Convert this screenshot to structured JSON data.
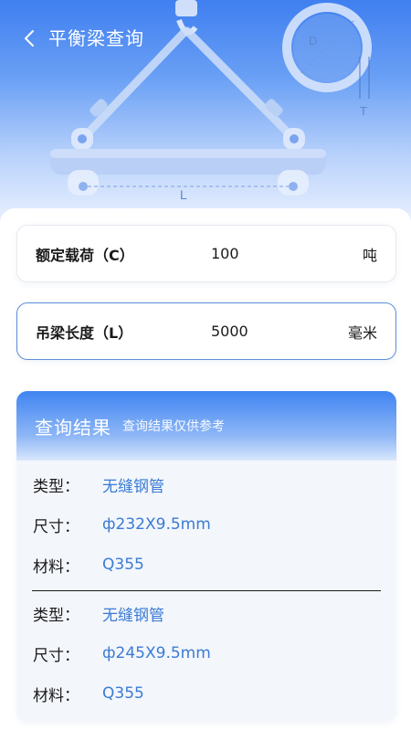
{
  "header": {
    "title": "平衡梁查询",
    "diagram_labels": {
      "diameter": "D",
      "thickness": "T",
      "length": "L"
    }
  },
  "fields": [
    {
      "label": "额定载荷（C）",
      "value": "100",
      "unit": "吨"
    },
    {
      "label": "吊梁长度（L）",
      "value": "5000",
      "unit": "毫米"
    }
  ],
  "result": {
    "title": "查询结果",
    "subtitle": "查询结果仅供参考",
    "groups": [
      {
        "type_key": "类型：",
        "type_val": "无缝钢管",
        "size_key": "尺寸：",
        "size_val": "ф232X9.5mm",
        "material_key": "材料：",
        "material_val": "Q355"
      },
      {
        "type_key": "类型：",
        "type_val": "无缝钢管",
        "size_key": "尺寸：",
        "size_val": "ф245X9.5mm",
        "material_key": "材料：",
        "material_val": "Q355"
      }
    ]
  },
  "colors": {
    "accent": "#3f7ff0",
    "value_text": "#3a7bd5",
    "active_border": "#5a8fd8"
  }
}
